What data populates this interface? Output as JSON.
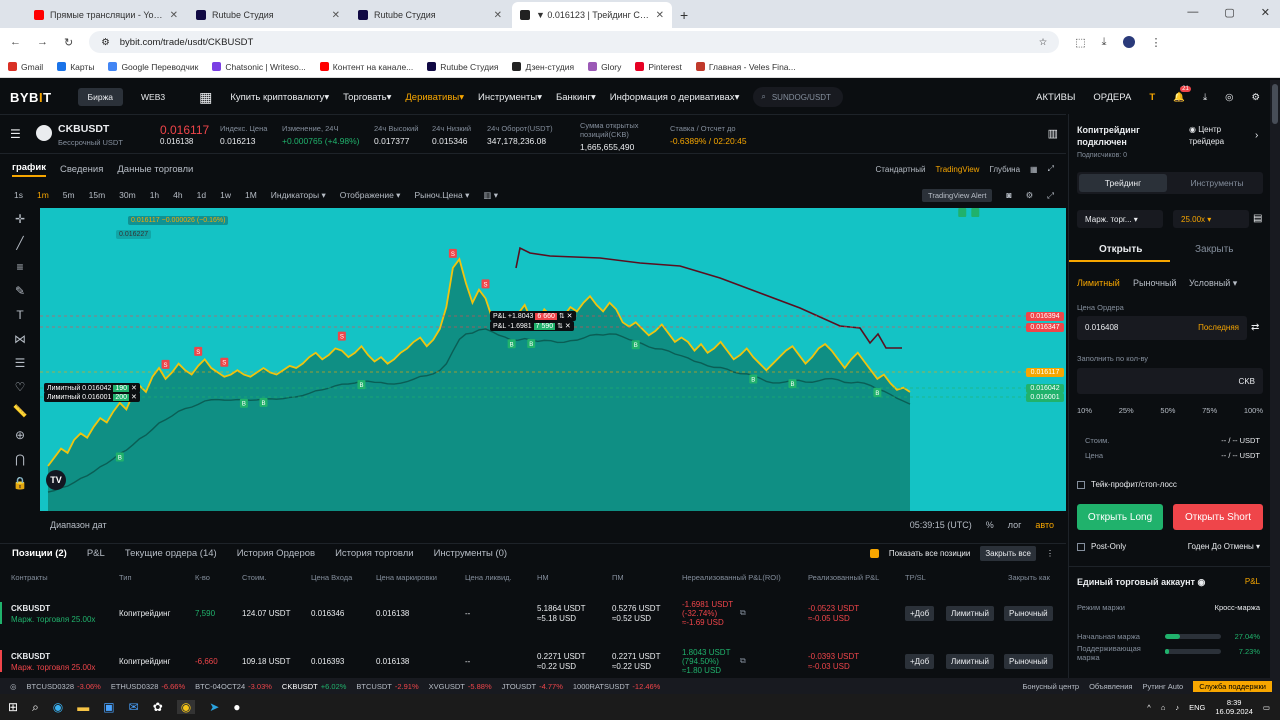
{
  "browser": {
    "tabs": [
      {
        "label": "Прямые трансляции - YouTube",
        "color": "#ff0000",
        "active": false
      },
      {
        "label": "Rutube Студия",
        "color": "#100943",
        "active": false
      },
      {
        "label": "Rutube Студия",
        "color": "#100943",
        "active": false
      },
      {
        "label": "▼ 0.016123 | Трейдинг CKBUS",
        "color": "#222222",
        "active": true
      }
    ],
    "url": "bybit.com/trade/usdt/CKBUSDT",
    "bookmarks": [
      "Gmail",
      "Карты",
      "Google Переводчик",
      "Chatsonic | Writeso...",
      "Контент на канале...",
      "Rutube Студия",
      "Дзен-студия",
      "Glory",
      "Pinterest",
      "Главная - Veles Fina..."
    ]
  },
  "header": {
    "logo_a": "BYB",
    "logo_b": "I",
    "logo_c": "T",
    "pill1": "Биржа",
    "pill2": "WEB3",
    "nav": [
      "Купить криптовалюту",
      "Торговать",
      "Деривативы",
      "Инструменты",
      "Банкинг",
      "Информация о деривативах"
    ],
    "search_placeholder": "SUNDOG/USDT",
    "assets": "АКТИВЫ",
    "orders": "ОРДЕРА",
    "badge": "21"
  },
  "ticker": {
    "symbol": "CKBUSDT",
    "subtitle": "Бессрочный USDT",
    "price": "0.016117",
    "price_sub": "0.016138",
    "items": [
      {
        "label": "Индекс. Цена",
        "value": "0.016213"
      },
      {
        "label": "Изменение, 24Ч",
        "value": "+0.000765 (+4.98%)"
      },
      {
        "label": "24ч Высокий",
        "value": "0.017377"
      },
      {
        "label": "24ч Низкий",
        "value": "0.015346"
      },
      {
        "label": "24ч Оборот(USDT)",
        "value": "347,178,236.08"
      },
      {
        "label": "Сумма открытых позиций(CKB)",
        "value": "1,665,655,490"
      },
      {
        "label": "Ставка / Отсчет до",
        "value": "-0.6389% / 02:20:45"
      }
    ]
  },
  "chart_tabs": {
    "tabs": [
      "график",
      "Сведения",
      "Данные торговли"
    ],
    "right": [
      "Стандартный",
      "TradingView",
      "Глубина"
    ]
  },
  "toolbar": {
    "intervals": [
      "1s",
      "1m",
      "5m",
      "15m",
      "30m",
      "1h",
      "4h",
      "1d",
      "1w",
      "1M"
    ],
    "items": [
      "Индикаторы",
      "Отображение",
      "Рыноч.Цена"
    ],
    "alert": "TradingView Alert"
  },
  "chart_data": {
    "type": "line",
    "series": [],
    "x": [
      0,
      1,
      2,
      3,
      4,
      5,
      6,
      7,
      8,
      9,
      10,
      11,
      12,
      13,
      14,
      15,
      16,
      17,
      18,
      19,
      20,
      21,
      22,
      23,
      24,
      25,
      26,
      27,
      28,
      29,
      30,
      31,
      32,
      33,
      34,
      35,
      36,
      37,
      38,
      39,
      40,
      41,
      42,
      43,
      44,
      45,
      46,
      47,
      48,
      49,
      50,
      51,
      52,
      53,
      54,
      55,
      56,
      57,
      58,
      59,
      60,
      61,
      62,
      63,
      64,
      65,
      66,
      67,
      68,
      69,
      70,
      71,
      72,
      73,
      74,
      75,
      76,
      77,
      78,
      79,
      80,
      81,
      82,
      83,
      84,
      85,
      86,
      87,
      88,
      89,
      90,
      91,
      92,
      93,
      94,
      95,
      96,
      97,
      98,
      99,
      100,
      101,
      102,
      103,
      104,
      105,
      106,
      107,
      108,
      109,
      110,
      111,
      112,
      113,
      114,
      115,
      116,
      117,
      118,
      119,
      120,
      121,
      122,
      123,
      124,
      125,
      126,
      127,
      128,
      129,
      130,
      131,
      132,
      133,
      134,
      135,
      136,
      137,
      138,
      139,
      140,
      141,
      142,
      143,
      144,
      145
    ],
    "price": [
      0.01577,
      0.01581,
      0.01585,
      0.01583,
      0.01589,
      0.01592,
      0.0159,
      0.01595,
      0.01599,
      0.01597,
      0.01602,
      0.01606,
      0.01603,
      0.0161,
      0.01614,
      0.01611,
      0.01618,
      0.01622,
      0.01617,
      0.0162,
      0.01624,
      0.01621,
      0.01619,
      0.01623,
      0.01626,
      0.01622,
      0.0162,
      0.01618,
      0.01619,
      0.01621,
      0.01619,
      0.01618,
      0.0162,
      0.01622,
      0.0162,
      0.01619,
      0.01621,
      0.01623,
      0.01622,
      0.01624,
      0.01627,
      0.01629,
      0.01626,
      0.01628,
      0.01631,
      0.0163,
      0.01627,
      0.01629,
      0.01632,
      0.01628,
      0.01625,
      0.01627,
      0.01624,
      0.01626,
      0.01629,
      0.01631,
      0.01634,
      0.01636,
      0.01632,
      0.01635,
      0.0164,
      0.0165,
      0.01668,
      0.01672,
      0.01661,
      0.01652,
      0.01658,
      0.01654,
      0.01645,
      0.01642,
      0.01644,
      0.0164,
      0.01647,
      0.01651,
      0.01644,
      0.01643,
      0.01649,
      0.01646,
      0.01642,
      0.01646,
      0.0165,
      0.01648,
      0.01652,
      0.01655,
      0.01651,
      0.01648,
      0.01652,
      0.01649,
      0.01643,
      0.01641,
      0.01643,
      0.0164,
      0.01637,
      0.01639,
      0.01642,
      0.01638,
      0.01634,
      0.01636,
      0.01634,
      0.0163,
      0.01633,
      0.01629,
      0.01631,
      0.01634,
      0.0163,
      0.01626,
      0.01628,
      0.01631,
      0.01627,
      0.01624,
      0.01621,
      0.01624,
      0.01627,
      0.0163,
      0.01632,
      0.01628,
      0.01624,
      0.01627,
      0.01631,
      0.01633,
      0.0163,
      0.01626,
      0.01622,
      0.01626,
      0.01629,
      0.01625,
      0.01621,
      0.01617,
      0.01619,
      0.01615,
      0.01612,
      0.01613,
      0.01611
    ],
    "pnl_buy": "P&L +1.8043",
    "pnl_buy_qty": "6 660",
    "pnl_sell": "P&L -1.6981",
    "pnl_sell_qty": "7 590",
    "limit1": "Лимитный 0.016042",
    "limit1_qty": "190",
    "limit2": "Лимитный 0.016001",
    "limit2_qty": "200",
    "legend_price": "0.016117 −0.000026 (−0.16%)",
    "legend2": "0.016227",
    "price_tags": [
      {
        "value": "0.016394",
        "color": "#ef454a"
      },
      {
        "value": "0.016347",
        "color": "#ef454a"
      },
      {
        "value": "0.016117",
        "color": "#f7a600"
      },
      {
        "value": "0.016042",
        "color": "#20b26c"
      },
      {
        "value": "0.016001",
        "color": "#20b26c"
      }
    ]
  },
  "dateline": {
    "range": "Диапазон дат",
    "time": "05:39:15 (UTC)",
    "pct": "%",
    "log": "лог",
    "auto": "авто"
  },
  "positions": {
    "tabs": [
      "Позиции (2)",
      "P&L",
      "Текущие ордера (14)",
      "История Ордеров",
      "История торговли",
      "Инструменты (0)"
    ],
    "show_all": "Показать все позиции",
    "close_all": "Закрыть все",
    "headers": [
      "Контракты",
      "Тип",
      "К-во",
      "Стоим.",
      "Цена Входа",
      "Цена маркировки",
      "Цена ликвид.",
      "НМ",
      "ПМ",
      "Нереализованный P&L(ROI)",
      "Реализованный P&L",
      "TP/SL",
      "Закрыть как"
    ],
    "rows": [
      {
        "contract": "CKBUSDT",
        "mode": "Марж. торговля 25.00x",
        "type": "Копитрейдинг",
        "qty": "7,590",
        "value": "124.07 USDT",
        "entry": "0.016346",
        "mark": "0.016138",
        "liq": "--",
        "im": "5.1864 USDT",
        "im2": "≈5.18 USD",
        "mm": "0.5276 USDT",
        "mm2": "≈0.52 USD",
        "upnl": "-1.6981 USDT",
        "upnl2": "(-32.74%)",
        "upnl3": "≈-1.69 USD",
        "rpnl": "-0.0523 USDT",
        "rpnl2": "≈-0.05 USD",
        "side": "long"
      },
      {
        "contract": "CKBUSDT",
        "mode": "Марж. торговля 25.00x",
        "type": "Копитрейдинг",
        "qty": "-6,660",
        "value": "109.18 USDT",
        "entry": "0.016393",
        "mark": "0.016138",
        "liq": "--",
        "im": "0.2271 USDT",
        "im2": "≈0.22 USD",
        "mm": "0.2271 USDT",
        "mm2": "≈0.22 USD",
        "upnl": "1.8043 USDT",
        "upnl2": "(794.50%)",
        "upnl3": "≈1.80 USD",
        "rpnl": "-0.0393 USDT",
        "rpnl2": "≈-0.03 USD",
        "side": "short"
      }
    ],
    "btn_add": "Доб",
    "btn_limit": "Лимитный",
    "btn_market": "Рыночный"
  },
  "rpanel": {
    "copy": "Копитрейдинг подключен",
    "subs": "Подписчиков: 0",
    "center": "Центр трейдера",
    "tab1": "Трейдинг",
    "tab2": "Инструменты",
    "margin": "Марж. торг...",
    "lev": "25.00x",
    "open": "Открыть",
    "close": "Закрыть",
    "ot1": "Лимитный",
    "ot2": "Рыночный",
    "ot3": "Условный",
    "price_label": "Цена Ордера",
    "price_value": "0.016408",
    "last": "Последняя",
    "qty_label": "Заполнить по кол-ву",
    "unit": "CKB",
    "pcts": [
      "10%",
      "25%",
      "50%",
      "75%",
      "100%"
    ],
    "cost": "Стоим.",
    "cost_v": "-- / -- USDT",
    "price2": "Цена",
    "price2_v": "-- / -- USDT",
    "tpsl": "Тейк-профит/стоп-лосс",
    "long": "Открыть Long",
    "short": "Открыть Short",
    "postonly": "Post-Only",
    "tif": "Годен До Отмены",
    "unified": "Единый торговый аккаунт",
    "pl": "P&L",
    "mode_label": "Режим маржи",
    "mode_value": "Кросс-маржа",
    "im_label": "Начальная маржа",
    "im_value": "27.04%",
    "im_fill": 0.27,
    "mm_label": "Поддерживающая маржа",
    "mm_value": "7.23%",
    "mm_fill": 0.07
  },
  "footer": {
    "items": [
      {
        "sym": "BTCUSD0328",
        "chg": "-3.06%",
        "c": "red"
      },
      {
        "sym": "ETHUSD0328",
        "chg": "-6.66%",
        "c": "red"
      },
      {
        "sym": "BTC-04OCT24",
        "chg": "-3.03%",
        "c": "red"
      },
      {
        "sym": "CKBUSDT",
        "chg": "+6.02%",
        "c": "green"
      },
      {
        "sym": "BTCUSDT",
        "chg": "-2.91%",
        "c": "red"
      },
      {
        "sym": "XVGUSDT",
        "chg": "-5.88%",
        "c": "red"
      },
      {
        "sym": "JTOUSDT",
        "chg": "-4.77%",
        "c": "red"
      },
      {
        "sym": "1000RATSUSDT",
        "chg": "-12.46%",
        "c": "red"
      }
    ],
    "right": [
      "Бонусный центр",
      "Объявления",
      "Рутинг Auto",
      "Служба поддержки"
    ]
  },
  "taskbar": {
    "lang": "ENG",
    "time": "8:39",
    "date": "16.09.2024"
  }
}
